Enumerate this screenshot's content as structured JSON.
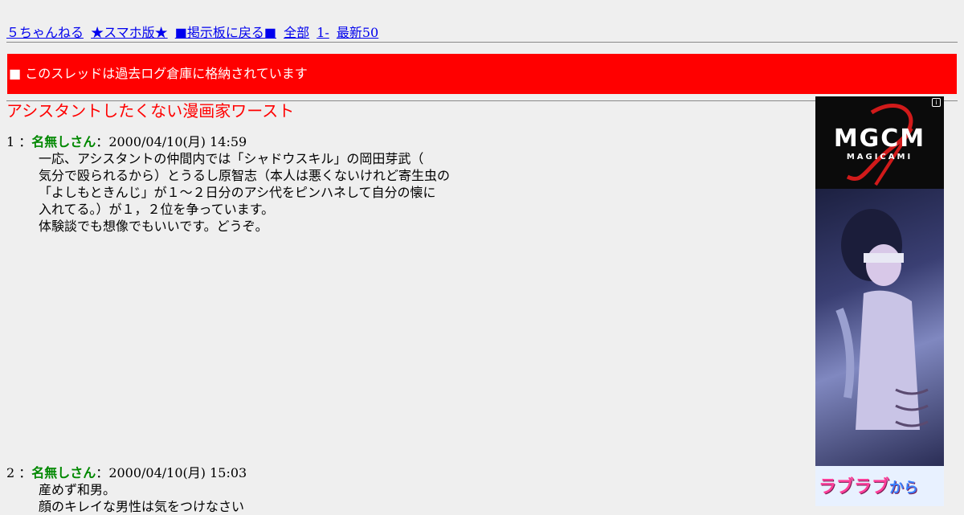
{
  "nav": {
    "links": [
      "５ちゃんねる",
      "★スマホ版★",
      "■掲示板に戻る■",
      "全部",
      "1-",
      "最新50"
    ]
  },
  "banner": {
    "text": "■ このスレッドは過去ログ倉庫に格納されています"
  },
  "thread": {
    "title": "アシスタントしたくない漫画家ワースト"
  },
  "posts": [
    {
      "number": "1",
      "separator": " ：",
      "name": "名無しさん",
      "date_sep": "：",
      "date": "2000/04/10(月) 14:59",
      "body": "一応、アシスタントの仲間内では「シャドウスキル」の岡田芽武（\n気分で殴られるから）とうるし原智志（本人は悪くないけれど寄生虫の\n「よしもときんじ」が１～２日分のアシ代をピンハネして自分の懐に\n入れてる。）が１，２位を争っています。\n体験談でも想像でもいいです。どうぞ。"
    },
    {
      "number": "2",
      "separator": " ：",
      "name": "名無しさん",
      "date_sep": "：",
      "date": "2000/04/10(月) 15:03",
      "body": "産めず和男。\n顔のキレイな男性は気をつけなさい"
    }
  ],
  "ad": {
    "logo": "MGCM",
    "sub": "MAGICAMI",
    "info": "i",
    "cta_pink": "ラブラブ",
    "cta_blue": "から"
  }
}
